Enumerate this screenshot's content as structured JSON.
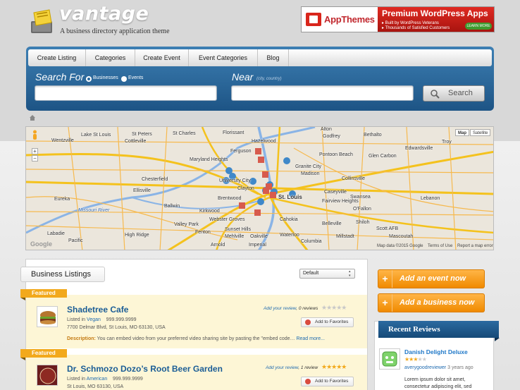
{
  "header": {
    "title": "vantage",
    "tagline": "A business directory application theme",
    "ad": {
      "brand": "AppThemes",
      "headline": "Premium WordPress Apps",
      "line1": "▸ Built by WordPress Veterans",
      "line2": "▸ Thousands of Satisfied Customers",
      "cta": "LEARN MORE",
      "colors": {
        "red": "#d9261c",
        "green": "#3d9b2f"
      }
    }
  },
  "nav": {
    "items": [
      {
        "label": "Create Listing"
      },
      {
        "label": "Categories"
      },
      {
        "label": "Create Event"
      },
      {
        "label": "Event Categories"
      },
      {
        "label": "Blog"
      }
    ]
  },
  "search": {
    "for_label": "Search For",
    "option_businesses": "Businesses",
    "option_events": "Events",
    "selected": "Businesses",
    "near_label": "Near",
    "near_hint": "(city, country)",
    "query_value": "",
    "location_value": "",
    "button_label": "Search"
  },
  "map": {
    "type_map": "Map",
    "type_satellite": "Satellite",
    "zoom_in": "+",
    "zoom_out": "−",
    "logo": "Google",
    "footer_data": "Map data ©2015 Google",
    "footer_terms": "Terms of Use",
    "footer_report": "Report a map error",
    "places": [
      "Lake St Louis",
      "St Peters",
      "St Charles",
      "Florissant",
      "Alton",
      "Godfrey",
      "Bethalto",
      "Edwardsville",
      "Troy",
      "Wentzville",
      "Cottleville",
      "Hazelwood",
      "Ferguson",
      "Granite City",
      "Pontoon Beach",
      "Glen Carbon",
      "Maryland Heights",
      "Madison",
      "Chesterfield",
      "University City",
      "Clayton",
      "Collinsville",
      "Ellisville",
      "Brentwood",
      "Caseyville",
      "Eureka",
      "Ballwin",
      "Kirkwood",
      "O'Fallon",
      "Valley Park",
      "Webster Groves",
      "Fenton",
      "Cahokia",
      "Belleville",
      "Shiloh",
      "Pacific",
      "Sunset Hills",
      "Columbia",
      "Scott AFB",
      "Mehlville",
      "Millstadt",
      "Mascoutah",
      "Labadie",
      "Arnold",
      "Imperial",
      "Waterloo",
      "Fairview Heights",
      "Swansea",
      "Lebanon",
      "High Ridge",
      "Oakville",
      "Missouri River",
      "St. Louis"
    ],
    "colors": {
      "road": "#f6b94e",
      "highway": "#f4c21d",
      "river": "#8ab4e6",
      "marker_blue": "#3f88c9",
      "marker_red": "#d75b4d"
    }
  },
  "listings": {
    "tab_label": "Business Listings",
    "sort_value": "Default",
    "featured_label": "Featured",
    "items": [
      {
        "title": "Shadetree Cafe",
        "listed_in": "Listed in",
        "category": "Vegan",
        "phone": "999.999.9999",
        "address": "7700 Delmar Blvd, St Louis, MO 63130, USA",
        "review_link": "Add your review",
        "review_count": ", 0 reviews",
        "rating": 0,
        "favorite_label": "Add to Favorites",
        "description_label": "Description:",
        "description": "You can embed video from your preferred video sharing site by pasting the \"embed code…",
        "read_more": "Read more..."
      },
      {
        "title": "Dr. Schmozo Dozo’s Root Beer Garden",
        "listed_in": "Listed in",
        "category": "American",
        "phone": "999.999.9999",
        "address": "St Louis, MO 63130, USA",
        "review_link": "Add your review",
        "review_count": ", 1 review",
        "rating": 5,
        "favorite_label": "Add to Favorites"
      }
    ]
  },
  "sidebar": {
    "add_event": "Add an event now",
    "add_business": "Add a business now",
    "recent_reviews_title": "Recent Reviews",
    "review": {
      "title": "Danish Delight Deluxe",
      "rating": 3,
      "reviewer": "averygoodreviewer",
      "ago": " 3 years ago",
      "text1": "Lorem ipsum dolor sit amet,",
      "text2": "consectetur adipiscing elit, sed"
    },
    "colors": {
      "orange": "#f29a1c",
      "blue": "#1f5c92"
    }
  }
}
